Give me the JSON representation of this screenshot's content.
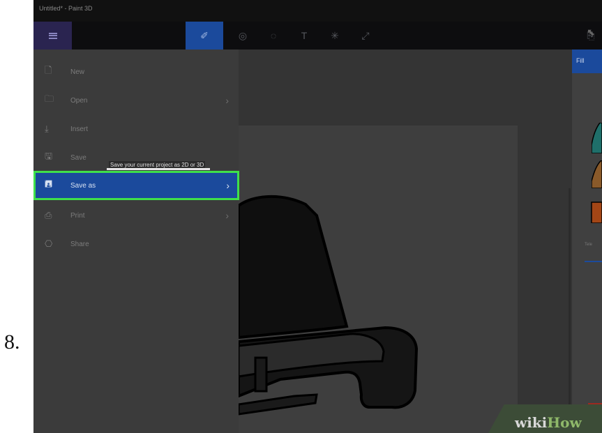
{
  "step_number": "8.",
  "window": {
    "title": "Untitled* - Paint 3D"
  },
  "toolbar": {
    "menu_icon": "hamburger-menu-icon",
    "tools": [
      {
        "name": "brush-tool",
        "glyph": "✐",
        "active": true
      },
      {
        "name": "3d-shapes-tool",
        "glyph": "◎",
        "active": false
      },
      {
        "name": "stickers-tool",
        "glyph": "◌",
        "active": false
      },
      {
        "name": "text-tool",
        "glyph": "T",
        "active": false
      },
      {
        "name": "effects-tool",
        "glyph": "✳",
        "active": false
      },
      {
        "name": "canvas-tool",
        "glyph": "⤢",
        "active": false
      }
    ],
    "right_icon": "paste-icon"
  },
  "menu": {
    "items": [
      {
        "label": "New",
        "icon": "new-file-icon",
        "glyph": "🗋",
        "has_submenu": false
      },
      {
        "label": "Open",
        "icon": "open-folder-icon",
        "glyph": "🗀",
        "has_submenu": true
      },
      {
        "label": "Insert",
        "icon": "insert-download-icon",
        "glyph": "⤓",
        "has_submenu": false
      },
      {
        "label": "Save",
        "icon": "save-disk-icon",
        "glyph": "🖫",
        "has_submenu": false
      },
      {
        "label": "Save as",
        "icon": "save-as-icon",
        "glyph": "🖪",
        "has_submenu": true,
        "selected": true
      },
      {
        "label": "Print",
        "icon": "print-icon",
        "glyph": "⎙",
        "has_submenu": true
      },
      {
        "label": "Share",
        "icon": "share-icon",
        "glyph": "⎔",
        "has_submenu": false
      }
    ],
    "tooltip": "Save your current project as 2D or 3D"
  },
  "right_panel": {
    "header": "Fill"
  },
  "watermark": {
    "part1": "wiki",
    "part2": "How"
  },
  "colors": {
    "accent": "#1b4a9c",
    "highlight": "#3fe04a",
    "menu_bg": "#3b3b3b",
    "toolbar_bg": "#0d0d0f"
  }
}
